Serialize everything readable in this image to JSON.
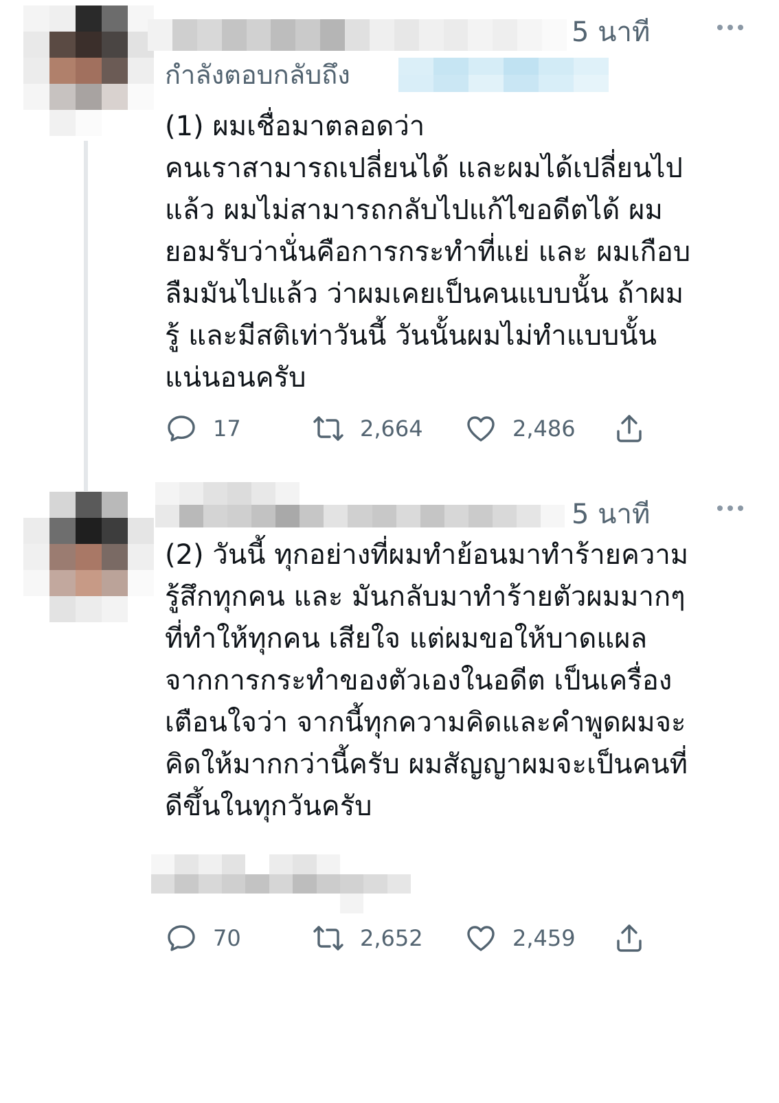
{
  "colors": {
    "text": "#0f1419",
    "muted": "#536471",
    "icon": "#8b98a5",
    "handle_blur": "#bfe3f3"
  },
  "tweets": [
    {
      "time": "5 นาที",
      "reply_label": "กำลังตอบกลับถึง",
      "body_lines": [
        "(1) ผมเชื่อมาตลอดว่า",
        "คนเราสามารถเปลี่ยนได้ และผมได้เปลี่ยนไป",
        "แล้ว ผมไม่สามารถกลับไปแก้ไขอดีตได้ ผม",
        "ยอมรับว่านั่นคือการกระทำที่แย่ และ ผมเกือบ",
        "ลืมมันไปแล้ว ว่าผมเคยเป็นคนแบบนั้น ถ้าผม",
        "รู้ และมีสติเท่าวันนี้ วันนั้นผมไม่ทำแบบนั้น",
        "แน่นอนครับ"
      ],
      "stats": {
        "replies": "17",
        "retweets": "2,664",
        "likes": "2,486"
      },
      "icons": {
        "reply": "reply-icon",
        "retweet": "retweet-icon",
        "like": "heart-icon",
        "share": "share-icon"
      }
    },
    {
      "time": "5 นาที",
      "body_lines": [
        "(2) วันนี้ ทุกอย่างที่ผมทำย้อนมาทำร้ายความ",
        "รู้สึกทุกคน และ มันกลับมาทำร้ายตัวผมมากๆ",
        "ที่ทำให้ทุกคน เสียใจ แต่ผมขอให้บาดแผล",
        "จากการกระทำของตัวเองในอดีต เป็นเครื่อง",
        "เตือนใจว่า จากนี้ทุกความคิดและคำพูดผมจะ",
        "คิดให้มากกว่านี้ครับ ผมสัญญาผมจะเป็นคนที่",
        "ดีขึ้นในทุกวันครับ"
      ],
      "stats": {
        "replies": "70",
        "retweets": "2,652",
        "likes": "2,459"
      },
      "icons": {
        "reply": "reply-icon",
        "retweet": "retweet-icon",
        "like": "heart-icon",
        "share": "share-icon"
      }
    }
  ]
}
